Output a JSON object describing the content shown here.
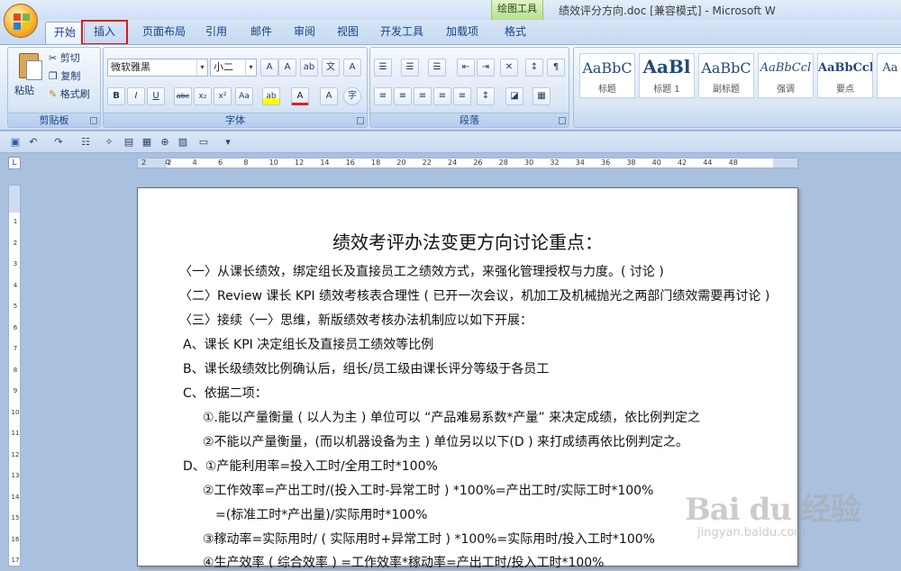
{
  "window": {
    "doc_title": "绩效评分方向.doc [兼容模式] - Microsoft W",
    "contextual_tab_group": "绘图工具"
  },
  "tabs": [
    "开始",
    "插入",
    "页面布局",
    "引用",
    "邮件",
    "审阅",
    "视图",
    "开发工具",
    "加载项",
    "格式"
  ],
  "ribbon": {
    "clipboard": {
      "paste": "粘贴",
      "cut": "剪切",
      "copy": "复制",
      "format_painter": "格式刷",
      "label": "剪贴板"
    },
    "font": {
      "font_name": "微软雅黑",
      "font_size": "小二",
      "label": "字体"
    },
    "paragraph": {
      "label": "段落"
    },
    "styles": [
      {
        "sample": "AaBbC",
        "name": "标题"
      },
      {
        "sample": "AaBl",
        "name": "标题 1"
      },
      {
        "sample": "AaBbC",
        "name": "副标题"
      },
      {
        "sample": "AaBbCcl",
        "name": "强调"
      },
      {
        "sample": "AaBbCcl",
        "name": "要点"
      },
      {
        "sample": "Aa",
        "name": ""
      }
    ]
  },
  "ruler": {
    "corner": "L",
    "h_ticks": [
      "2",
      "2",
      "4",
      "6",
      "8",
      "10",
      "12",
      "14",
      "16",
      "18",
      "20",
      "22",
      "24",
      "26",
      "28",
      "30",
      "32",
      "34",
      "36",
      "38",
      "40",
      "42",
      "44",
      "48"
    ],
    "v_ticks": [
      "1",
      "2",
      "3",
      "4",
      "5",
      "6",
      "7",
      "8",
      "9",
      "10",
      "11",
      "12",
      "13",
      "14",
      "15",
      "16",
      "17"
    ]
  },
  "document": {
    "heading": "绩效考评办法变更方向讨论重点：",
    "lines": [
      "〈一〉从课长绩效，绑定组长及直接员工之绩效方式，来强化管理授权与力度。( 讨论 )",
      "〈二〉Review 课长 KPI 绩效考核表合理性 ( 已开一次会议，机加工及机械抛光之两部门绩效需要再讨论 )",
      "〈三〉接续〈一〉思维，新版绩效考核办法机制应以如下开展：",
      "A、课长 KPI 决定组长及直接员工绩效等比例",
      "B、课长级绩效比例确认后，组长/员工级由课长评分等级于各员工",
      "C、依据二项：",
      "①.能以产量衡量 ( 以人为主 ) 单位可以 “产品难易系数*产量” 来决定成绩，依比例判定之",
      "②不能以产量衡量，(而以机器设备为主 ) 单位另以以下(D ) 来打成绩再依比例判定之。",
      "D、①产能利用率=投入工时/全用工时*100%",
      "②工作效率=产出工时/(投入工时-异常工时 ) *100%=产出工时/实际工时*100%",
      "=(标准工时*产出量)/实际用时*100%",
      "③稼动率=实际用时/ ( 实际用时+异常工时 ) *100%=实际用时/投入工时*100%",
      "④生产效率 ( 综合效率 ) =工作效率*稼动率=产出工时/投入工时*100%"
    ]
  },
  "watermark": {
    "logo": "Bai du 经验",
    "url": "jingyan.baidu.com"
  }
}
